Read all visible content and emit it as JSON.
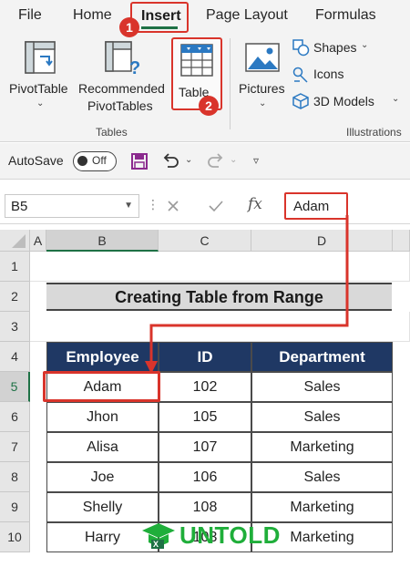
{
  "ribbon_tabs": {
    "file": "File",
    "home": "Home",
    "insert": "Insert",
    "page_layout": "Page Layout",
    "formulas": "Formulas"
  },
  "step_badges": [
    "1",
    "2"
  ],
  "ribbon": {
    "pivottable": "PivotTable",
    "recommended_line1": "Recommended",
    "recommended_line2": "PivotTables",
    "table": "Table",
    "tables_group": "Tables",
    "pictures": "Pictures",
    "shapes": "Shapes",
    "icons": "Icons",
    "models_3d": "3D Models",
    "illustrations_group": "Illustrations"
  },
  "quick_access": {
    "autosave_label": "AutoSave",
    "autosave_state": "Off"
  },
  "formula_bar": {
    "name_box": "B5",
    "formula_value": "Adam",
    "fx": "fx"
  },
  "columns": [
    "A",
    "B",
    "C",
    "D"
  ],
  "rows": [
    "1",
    "2",
    "3",
    "4",
    "5",
    "6",
    "7",
    "8",
    "9",
    "10"
  ],
  "sheet": {
    "title": "Creating Table from Range",
    "headers": [
      "Employee",
      "ID",
      "Department"
    ],
    "records": [
      [
        "Adam",
        "102",
        "Sales"
      ],
      [
        "Jhon",
        "105",
        "Sales"
      ],
      [
        "Alisa",
        "107",
        "Marketing"
      ],
      [
        "Joe",
        "106",
        "Sales"
      ],
      [
        "Shelly",
        "108",
        "Marketing"
      ],
      [
        "Harry",
        "103",
        "Marketing"
      ]
    ]
  },
  "watermark": "UNTOLD",
  "colors": {
    "accent_red": "#d9342b",
    "header_navy": "#1f3864",
    "excel_green": "#1e7145"
  }
}
